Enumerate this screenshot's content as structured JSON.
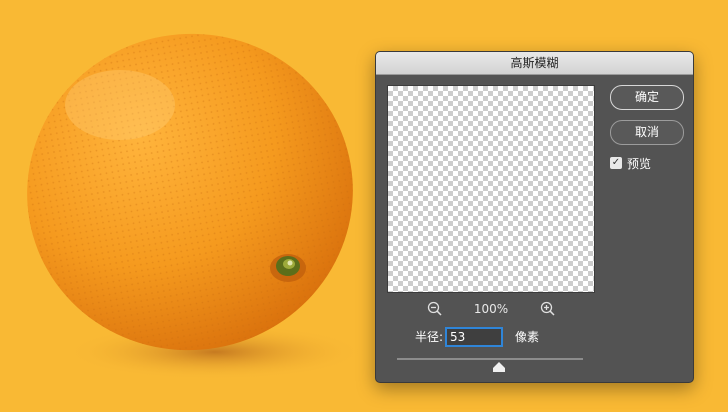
{
  "dialog": {
    "title": "高斯模糊",
    "ok_label": "确定",
    "cancel_label": "取消",
    "preview_label": "预览",
    "preview_checked": true
  },
  "zoom": {
    "level": "100%",
    "zoom_out_icon": "zoom-out-icon",
    "zoom_in_icon": "zoom-in-icon"
  },
  "radius": {
    "label": "半径:",
    "value": "53",
    "unit": "像素",
    "slider_fraction": 0.55
  },
  "colors": {
    "background": "#F9B934",
    "dialog_bg": "#535353",
    "focus_ring": "#2F85D8"
  }
}
